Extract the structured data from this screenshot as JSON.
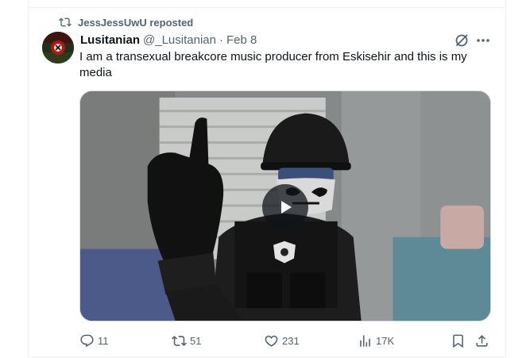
{
  "repost": {
    "text": "JessJessUwU reposted",
    "icon": "repost-icon"
  },
  "author": {
    "display_name": "Lusitanian",
    "handle": "@_Lusitanian",
    "separator": "·",
    "date": "Feb 8",
    "avatar": "avatar-image"
  },
  "tweet": {
    "text": "I am a transexual breakcore music producer from Eskisehir and this is my media"
  },
  "media": {
    "type": "video",
    "play_icon": "play-icon"
  },
  "actions": {
    "reply_count": "11",
    "repost_count": "51",
    "like_count": "231",
    "views_count": "17K"
  },
  "colors": {
    "secondary_text": "#536471",
    "primary_text": "#0f1419",
    "border": "#eff3f4"
  }
}
